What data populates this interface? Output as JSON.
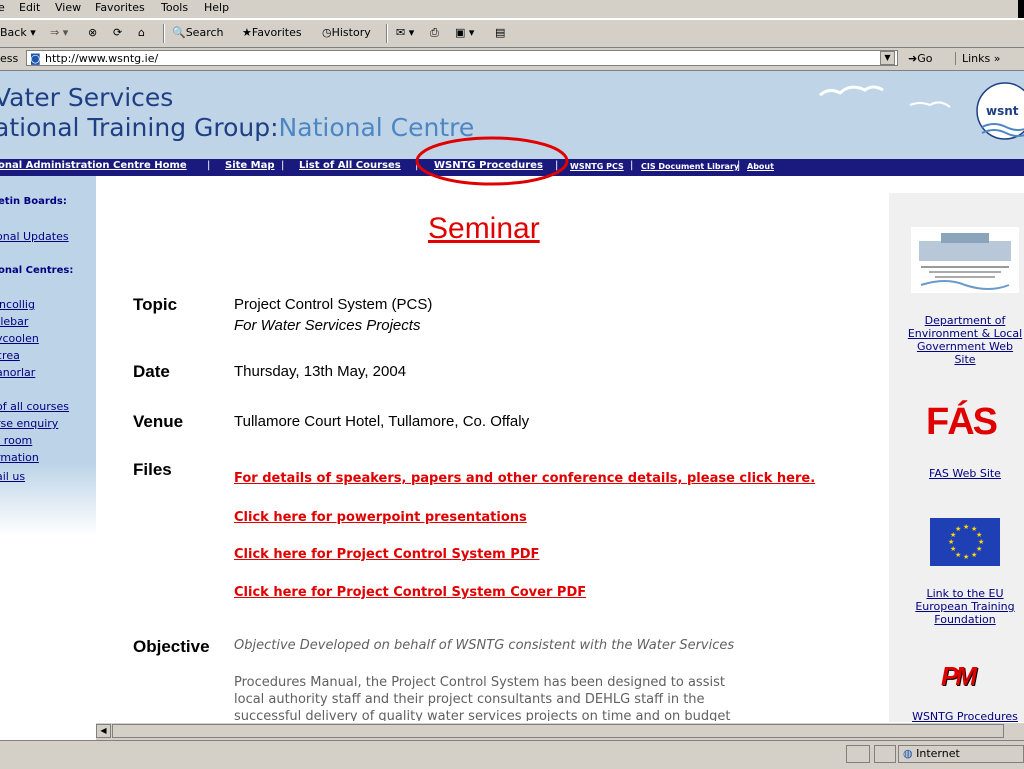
{
  "menu": {
    "items": [
      "e",
      "Edit",
      "View",
      "Favorites",
      "Tools",
      "Help"
    ]
  },
  "toolbar": {
    "back": "Back",
    "search": "Search",
    "favorites": "Favorites",
    "history": "History"
  },
  "address": {
    "label": "ess",
    "url": "http://www.wsntg.ie/",
    "go": "Go",
    "links": "Links"
  },
  "banner": {
    "title_line1": "Vater Services",
    "title_line2a": "ational Training Group:",
    "title_line2b": "National Centre",
    "logo_text": "wsnt"
  },
  "nav": {
    "items": [
      "onal Administration Centre Home",
      "Site Map",
      "List of All Courses",
      "WSNTG Procedures"
    ],
    "small_items": [
      "WSNTG PCS",
      "CIS Document Library",
      "About"
    ]
  },
  "sidebar": {
    "items": [
      "etin Boards:",
      "onal Updates",
      "onal Centres:",
      "incollig",
      "tlebar",
      "ycoolen",
      "crea",
      "anorlar",
      "of all courses",
      "rse enquiry",
      "t room",
      "rmation",
      "ail us"
    ]
  },
  "main": {
    "title": "Seminar",
    "topic_label": "Topic",
    "topic_value": "Project Control System (PCS)",
    "topic_sub": "For Water Services Projects",
    "date_label": "Date",
    "date_value": "Thursday, 13th May, 2004",
    "venue_label": "Venue",
    "venue_value": "Tullamore Court Hotel, Tullamore, Co. Offaly",
    "files_label": "Files",
    "files": [
      "For details of speakers, papers and other conference details, please click here.",
      "Click here for powerpoint presentations",
      "Click here for Project Control System PDF",
      "Click here for Project Control System Cover PDF"
    ],
    "objective_label": "Objective",
    "objective_line1": "Objective Developed on behalf of WSNTG consistent with the Water Services",
    "objective_para": [
      "Procedures Manual, the Project Control System has been designed to assist",
      "local authority staff and their project consultants and DEHLG staff in the",
      "successful delivery of quality water services projects on time and on budget"
    ]
  },
  "right": {
    "dept_link": [
      "Department of",
      "Environment & Local",
      "Government Web",
      "Site"
    ],
    "fas_logo": "FÁS",
    "fas_link": "FAS Web Site",
    "eu_link": [
      "Link to the EU",
      "European Training",
      "Foundation"
    ],
    "pm_logo": "PM",
    "wsntg_link": "WSNTG Procedures"
  },
  "status": {
    "zone": "Internet"
  },
  "colors": {
    "banner_bg": "#bfd5e7",
    "nav_bg": "#1a1a7e",
    "link_red": "#e00000",
    "title_blue": "#1f3f84"
  }
}
